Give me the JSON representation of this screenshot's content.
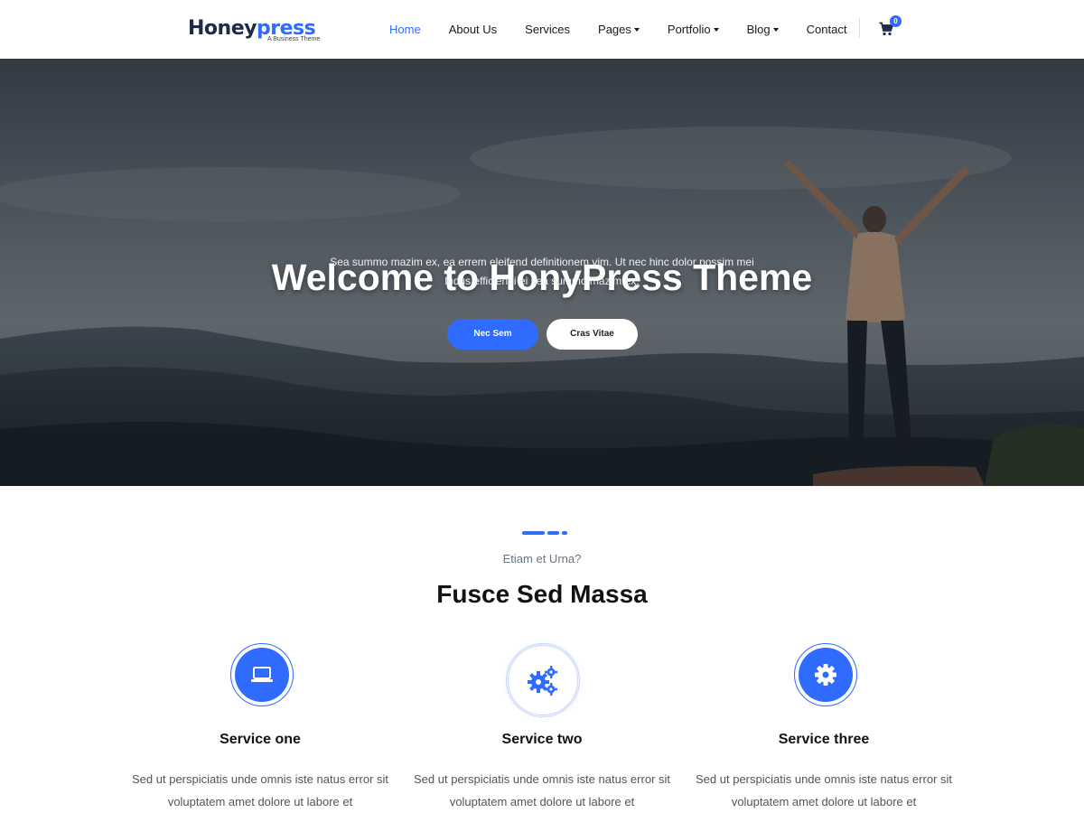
{
  "brand": {
    "logo_h": "H",
    "logo_oney": "oney",
    "logo_press": "press",
    "tagline": "A Business Theme"
  },
  "nav": {
    "items": [
      {
        "label": "Home",
        "active": true,
        "dropdown": false
      },
      {
        "label": "About Us",
        "active": false,
        "dropdown": false
      },
      {
        "label": "Services",
        "active": false,
        "dropdown": false
      },
      {
        "label": "Pages",
        "active": false,
        "dropdown": true
      },
      {
        "label": "Portfolio",
        "active": false,
        "dropdown": true
      },
      {
        "label": "Blog",
        "active": false,
        "dropdown": true
      },
      {
        "label": "Contact",
        "active": false,
        "dropdown": false
      }
    ],
    "cart_icon": "shopping-cart-icon",
    "cart_count": "0"
  },
  "hero": {
    "title": "Welcome to HonyPress Theme",
    "subtitle": "Sea summo mazim ex, ea errem eleifend definitionem vim. Ut nec hinc dolor possim mei ludus efficiendi ei sea summo mazim ex.",
    "primary_button": "Nec Sem",
    "secondary_button": "Cras Vitae"
  },
  "services_section": {
    "eyebrow": "Etiam et Urna?",
    "title": "Fusce Sed Massa",
    "items": [
      {
        "icon": "laptop-icon",
        "title": "Service one",
        "text": "Sed ut perspiciatis unde omnis iste natus error sit voluptatem amet dolore ut labore et"
      },
      {
        "icon": "gears-icon",
        "title": "Service two",
        "text": "Sed ut perspiciatis unde omnis iste natus error sit voluptatem amet dolore ut labore et"
      },
      {
        "icon": "gear-icon",
        "title": "Service three",
        "text": "Sed ut perspiciatis unde omnis iste natus error sit voluptatem amet dolore ut labore et"
      }
    ]
  },
  "colors": {
    "accent": "#2f6bff",
    "text_dark": "#121212",
    "text_muted": "#555555"
  }
}
